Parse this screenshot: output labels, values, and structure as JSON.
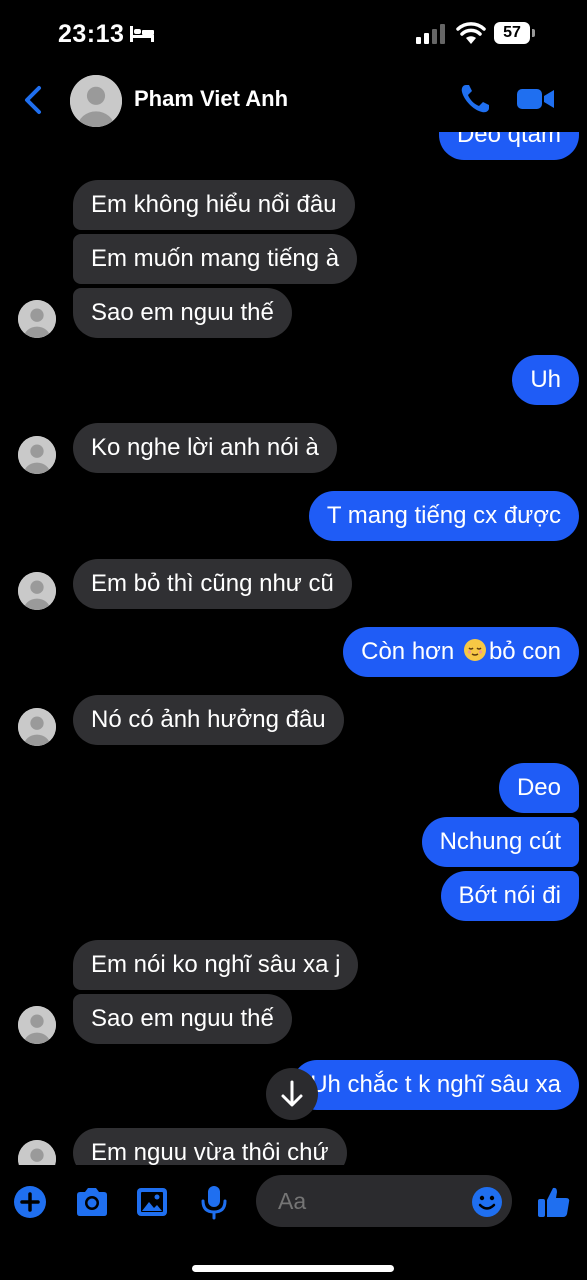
{
  "status_bar": {
    "time": "23:13",
    "battery": "57"
  },
  "header": {
    "contact_name": "Pham Viet Anh"
  },
  "colors": {
    "outgoing": "#1f5cf6",
    "incoming": "#303033",
    "accent": "#1f6ff0"
  },
  "messages": [
    {
      "from": "me",
      "text": "Deo qtam"
    },
    {
      "from": "them",
      "text": "Em không hiểu nổi đâu"
    },
    {
      "from": "them",
      "text": "Em muốn mang tiếng à"
    },
    {
      "from": "them",
      "text": "Sao em nguu thế"
    },
    {
      "from": "me",
      "text": "Uh"
    },
    {
      "from": "them",
      "text": "Ko nghe lời anh nói à"
    },
    {
      "from": "me",
      "text": "T mang tiếng cx được"
    },
    {
      "from": "them",
      "text": "Em bỏ thì cũng như cũ"
    },
    {
      "from": "me",
      "text_before": "Còn hơn",
      "emoji": "relieved-face",
      "text_after": "bỏ con"
    },
    {
      "from": "them",
      "text": "Nó có ảnh hưởng đâu"
    },
    {
      "from": "me",
      "text": "Deo"
    },
    {
      "from": "me",
      "text": "Nchung cút"
    },
    {
      "from": "me",
      "text": "Bớt nói đi"
    },
    {
      "from": "them",
      "text": "Em nói ko nghĩ sâu xa j"
    },
    {
      "from": "them",
      "text": "Sao em nguu thế"
    },
    {
      "from": "me",
      "text": "Uh chắc t k nghĩ sâu xa"
    },
    {
      "from": "them",
      "text": "Em nguu vừa thôi chứ"
    }
  ],
  "composer": {
    "placeholder": "Aa",
    "icons": [
      "plus-icon",
      "camera-icon",
      "image-icon",
      "microphone-icon",
      "emoji-icon",
      "thumbs-up-icon"
    ]
  }
}
